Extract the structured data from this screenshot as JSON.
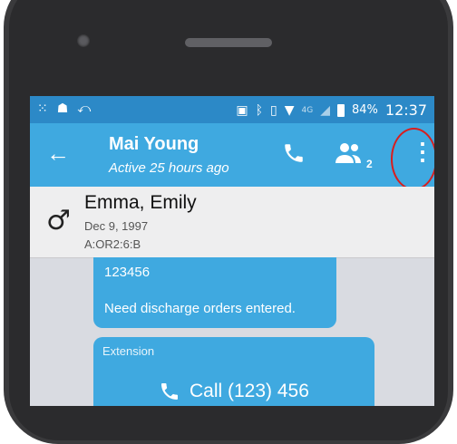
{
  "status_bar": {
    "left_icons": [
      "notification-icon",
      "android-icon",
      "missed-call-icon"
    ],
    "right_icons": [
      "cast-icon",
      "bluetooth-icon",
      "vibrate-icon",
      "wifi-icon",
      "signal-icon"
    ],
    "network": "4G",
    "battery": "84%",
    "time": "12:37"
  },
  "app_bar": {
    "title": "Mai Young",
    "subtitle": "Active 25 hours ago",
    "group_count": "2",
    "accent": "#3fa9e0"
  },
  "patient": {
    "name": "Emma, Emily",
    "dob": "Dec 9, 1997",
    "id": "A:OR2:6:B",
    "gender_icon": "male-icon"
  },
  "messages": [
    {
      "lines": [
        "123456",
        "Need discharge orders entered."
      ]
    },
    {
      "label": "Extension",
      "call_text": "Call (123) 456"
    }
  ]
}
